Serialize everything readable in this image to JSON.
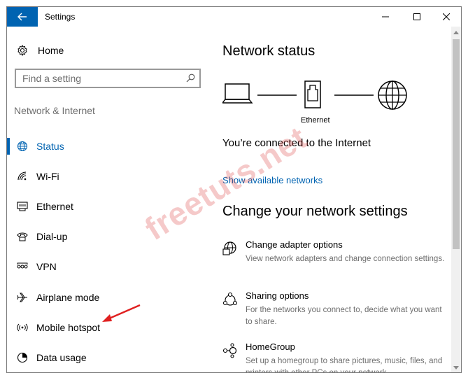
{
  "window": {
    "title": "Settings"
  },
  "sidebar": {
    "home_label": "Home",
    "search_placeholder": "Find a setting",
    "section_label": "Network & Internet",
    "items": [
      {
        "label": "Status",
        "icon": "globe-icon",
        "active": true
      },
      {
        "label": "Wi-Fi",
        "icon": "wifi-icon"
      },
      {
        "label": "Ethernet",
        "icon": "ethernet-icon"
      },
      {
        "label": "Dial-up",
        "icon": "dialup-icon"
      },
      {
        "label": "VPN",
        "icon": "vpn-icon"
      },
      {
        "label": "Airplane mode",
        "icon": "airplane-icon"
      },
      {
        "label": "Mobile hotspot",
        "icon": "hotspot-icon"
      },
      {
        "label": "Data usage",
        "icon": "data-usage-icon"
      }
    ]
  },
  "main": {
    "title": "Network status",
    "diagram": {
      "ethernet_label": "Ethernet"
    },
    "connection_status": "You’re connected to the Internet",
    "show_networks_link": "Show available networks",
    "change_title": "Change your network settings",
    "options": [
      {
        "title": "Change adapter options",
        "description": "View network adapters and change connection settings.",
        "icon": "adapter-icon"
      },
      {
        "title": "Sharing options",
        "description": "For the networks you connect to, decide what you want to share.",
        "icon": "sharing-icon"
      },
      {
        "title": "HomeGroup",
        "description": "Set up a homegroup to share pictures, music, files, and printers with other PCs on your network.",
        "icon": "homegroup-icon"
      }
    ]
  },
  "watermark": "freetuts.net",
  "colors": {
    "accent": "#0063b1",
    "secondary_text": "#6e6e6e",
    "annotation_arrow": "#e02020"
  }
}
